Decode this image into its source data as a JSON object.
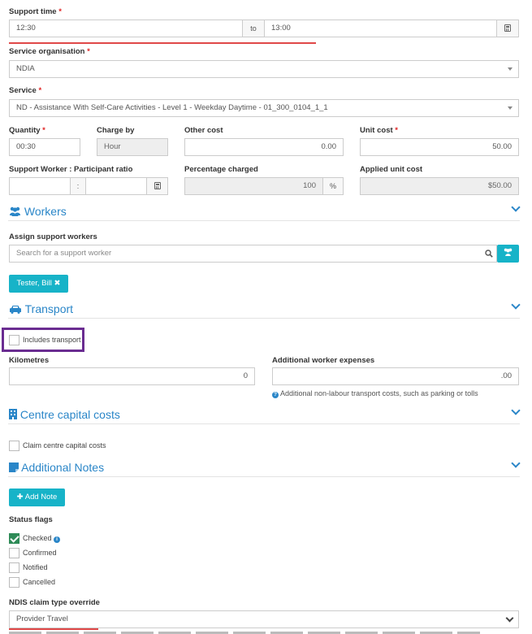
{
  "support_time": {
    "label": "Support time",
    "start": "12:30",
    "to": "to",
    "end": "13:00"
  },
  "service_org": {
    "label": "Service organisation",
    "value": "NDIA"
  },
  "service": {
    "label": "Service",
    "value": "ND - Assistance With Self-Care Activities - Level 1 - Weekday Daytime - 01_300_0104_1_1"
  },
  "quantity": {
    "label": "Quantity",
    "value": "00:30"
  },
  "charge_by": {
    "label": "Charge by",
    "value": "Hour"
  },
  "other_cost": {
    "label": "Other cost",
    "value": "0.00"
  },
  "unit_cost": {
    "label": "Unit cost",
    "value": "50.00"
  },
  "ratio": {
    "label": "Support Worker : Participant ratio",
    "sep": ":"
  },
  "percentage": {
    "label": "Percentage charged",
    "value": "100",
    "unit": "%"
  },
  "applied_unit_cost": {
    "label": "Applied unit cost",
    "value": "$50.00"
  },
  "workers": {
    "title": "Workers",
    "assign_label": "Assign support workers",
    "search_placeholder": "Search for a support worker",
    "tag": "Tester, Bill ✖"
  },
  "transport": {
    "title": "Transport",
    "includes_label": "Includes transport",
    "km_label": "Kilometres",
    "km_value": "0",
    "expenses_label": "Additional worker expenses",
    "expenses_value": ".00",
    "help": "Additional non-labour transport costs, such as parking or tolls"
  },
  "centre": {
    "title": "Centre capital costs",
    "claim_label": "Claim centre capital costs"
  },
  "notes": {
    "title": "Additional Notes",
    "add_button": "✚ Add Note"
  },
  "status": {
    "title": "Status flags",
    "flags": [
      {
        "label": "Checked",
        "checked": true
      },
      {
        "label": "Confirmed",
        "checked": false
      },
      {
        "label": "Notified",
        "checked": false
      },
      {
        "label": "Cancelled",
        "checked": false
      }
    ]
  },
  "ndis": {
    "label": "NDIS claim type override",
    "value": "Provider Travel"
  },
  "colors": {
    "accent": "#2a86c8",
    "teal": "#17b3c8",
    "required": "#e02424",
    "highlight": "#6a2c91",
    "underline": "#e04848"
  }
}
